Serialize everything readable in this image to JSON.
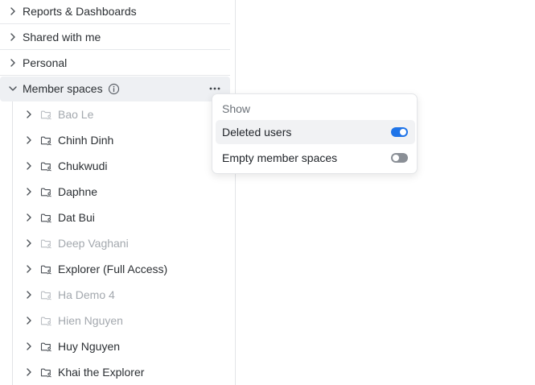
{
  "colors": {
    "toggle_on": "#1f74e8",
    "toggle_off": "#8a8f96",
    "muted_text": "#a3a8ae"
  },
  "sections": [
    {
      "label": "Reports & Dashboards",
      "expanded": false,
      "icon": "chevron-right-icon"
    },
    {
      "label": "Shared with me",
      "expanded": false,
      "icon": "chevron-right-icon"
    },
    {
      "label": "Personal",
      "expanded": false,
      "icon": "chevron-right-icon"
    },
    {
      "label": "Member spaces",
      "expanded": true,
      "icon": "chevron-down-icon"
    }
  ],
  "member_spaces": [
    {
      "name": "Bao Le",
      "deleted": true
    },
    {
      "name": "Chinh Dinh",
      "deleted": false
    },
    {
      "name": "Chukwudi",
      "deleted": false
    },
    {
      "name": "Daphne",
      "deleted": false
    },
    {
      "name": "Dat Bui",
      "deleted": false
    },
    {
      "name": "Deep Vaghani",
      "deleted": true
    },
    {
      "name": "Explorer (Full Access)",
      "deleted": false
    },
    {
      "name": "Ha Demo 4",
      "deleted": true
    },
    {
      "name": "Hien Nguyen",
      "deleted": true
    },
    {
      "name": "Huy Nguyen",
      "deleted": false
    },
    {
      "name": "Khai the Explorer",
      "deleted": false
    }
  ],
  "popover": {
    "heading": "Show",
    "options": [
      {
        "label": "Deleted users",
        "enabled": true
      },
      {
        "label": "Empty member spaces",
        "enabled": false
      }
    ]
  }
}
